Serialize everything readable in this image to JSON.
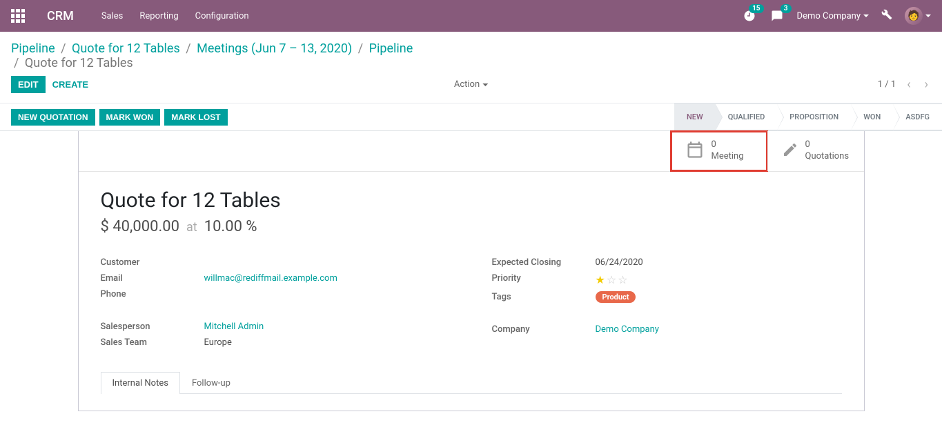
{
  "navbar": {
    "brand": "CRM",
    "menu": [
      "Sales",
      "Reporting",
      "Configuration"
    ],
    "clock_badge": "15",
    "chat_badge": "3",
    "company": "Demo Company"
  },
  "breadcrumbs": {
    "items": [
      "Pipeline",
      "Quote for 12 Tables",
      "Meetings (Jun 7 – 13, 2020)",
      "Pipeline"
    ],
    "current": "Quote for 12 Tables"
  },
  "controls": {
    "edit": "EDIT",
    "create": "CREATE",
    "action": "Action",
    "pager": "1 / 1"
  },
  "status_buttons": {
    "new_quotation": "NEW QUOTATION",
    "mark_won": "MARK WON",
    "mark_lost": "MARK LOST"
  },
  "stages": [
    "NEW",
    "QUALIFIED",
    "PROPOSITION",
    "WON",
    "ASDFG"
  ],
  "active_stage": "NEW",
  "stat_buttons": {
    "meeting": {
      "count": "0",
      "label": "Meeting"
    },
    "quotations": {
      "count": "0",
      "label": "Quotations"
    }
  },
  "record": {
    "title": "Quote for 12 Tables",
    "revenue": "$ 40,000.00",
    "at_label": "at",
    "probability": "10.00 %"
  },
  "fields": {
    "left": {
      "customer": {
        "label": "Customer",
        "value": ""
      },
      "email": {
        "label": "Email",
        "value": "willmac@rediffmail.example.com"
      },
      "phone": {
        "label": "Phone",
        "value": ""
      },
      "salesperson": {
        "label": "Salesperson",
        "value": "Mitchell Admin"
      },
      "sales_team": {
        "label": "Sales Team",
        "value": "Europe"
      }
    },
    "right": {
      "expected_closing": {
        "label": "Expected Closing",
        "value": "06/24/2020"
      },
      "priority": {
        "label": "Priority",
        "rating": 1
      },
      "tags": {
        "label": "Tags",
        "value": "Product"
      },
      "company": {
        "label": "Company",
        "value": "Demo Company"
      }
    }
  },
  "tabs": [
    "Internal Notes",
    "Follow-up"
  ],
  "active_tab": "Internal Notes"
}
